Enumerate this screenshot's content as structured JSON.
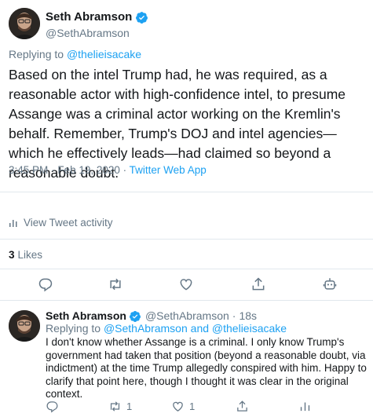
{
  "main_tweet": {
    "display_name": "Seth Abramson",
    "handle": "@SethAbramson",
    "replying_prefix": "Replying to",
    "replying_to": "@thelieisacake",
    "text": "Based on the intel Trump had, he was required, as a reasonable actor with high-confidence intel, to presume Assange was a criminal actor working on the Kremlin's behalf. Remember, Trump's DOJ and intel agencies—which he effectively leads—had claimed so beyond a reasonable doubt.",
    "time": "3:45 PM",
    "date": "Feb 19, 2020",
    "separator": "·",
    "app": "Twitter Web App",
    "view_activity": "View Tweet activity",
    "likes_count": "3",
    "likes_label": "Likes"
  },
  "reply_tweet": {
    "display_name": "Seth Abramson",
    "handle": "@SethAbramson",
    "separator": "·",
    "time": "18s",
    "replying_prefix": "Replying to",
    "replying_to_1": "@SethAbramson",
    "replying_and": "and",
    "replying_to_2": "@thelieisacake",
    "text": "I don't know whether Assange is a criminal. I only know Trump's government had taken that position (beyond a reasonable doubt, via indictment) at the time Trump allegedly conspired with him. Happy to clarify that point here, though I thought it was clear in the original context.",
    "retweet_count": "1",
    "like_count": "1"
  },
  "icons": {
    "verified": "verified-badge-icon",
    "reply": "reply-icon",
    "retweet": "retweet-icon",
    "like": "heart-icon",
    "share": "share-icon",
    "analytics": "analytics-bars-icon",
    "bot": "bot-icon"
  },
  "colors": {
    "accent": "#1da1f2",
    "text": "#14171a",
    "muted": "#657786",
    "divider": "#e1e8ed"
  }
}
